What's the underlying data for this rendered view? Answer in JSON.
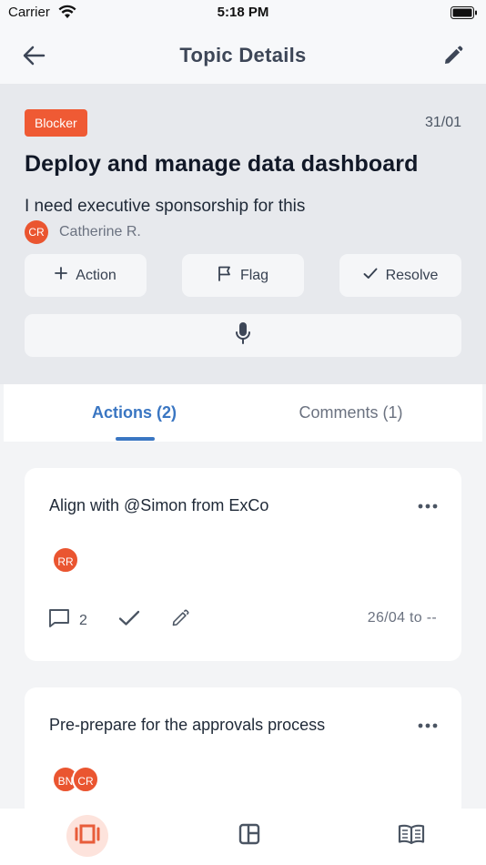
{
  "status_bar": {
    "carrier": "Carrier",
    "time": "5:18 PM"
  },
  "nav": {
    "title": "Topic Details"
  },
  "topic": {
    "badge": "Blocker",
    "date": "31/01",
    "title": "Deploy and manage data dashboard",
    "description": "I need executive sponsorship for this",
    "author_initials": "CR",
    "author_name": "Catherine R."
  },
  "buttons": {
    "action": "Action",
    "flag": "Flag",
    "resolve": "Resolve"
  },
  "tabs": {
    "actions": "Actions (2)",
    "comments": "Comments (1)"
  },
  "actions": [
    {
      "title": "Align with @Simon from ExCo",
      "assignees": [
        "RR"
      ],
      "comment_count": "2",
      "date_range": "26/04 to --"
    },
    {
      "title": "Pre-prepare for the approvals process",
      "assignees": [
        "BN",
        "CR"
      ]
    }
  ],
  "colors": {
    "accent": "#3a76c2",
    "badge": "#ef5a34",
    "avatar": "#ea5530",
    "bottom_active": "#e85d3a"
  },
  "icons": {
    "back": "arrow-left-icon",
    "edit": "pencil-icon",
    "plus": "plus-icon",
    "flag": "flag-icon",
    "check": "check-icon",
    "mic": "microphone-icon",
    "more": "more-horizontal-icon",
    "comment": "comment-icon",
    "bottom_nav": [
      "carousel-icon",
      "board-icon",
      "book-icon"
    ]
  }
}
